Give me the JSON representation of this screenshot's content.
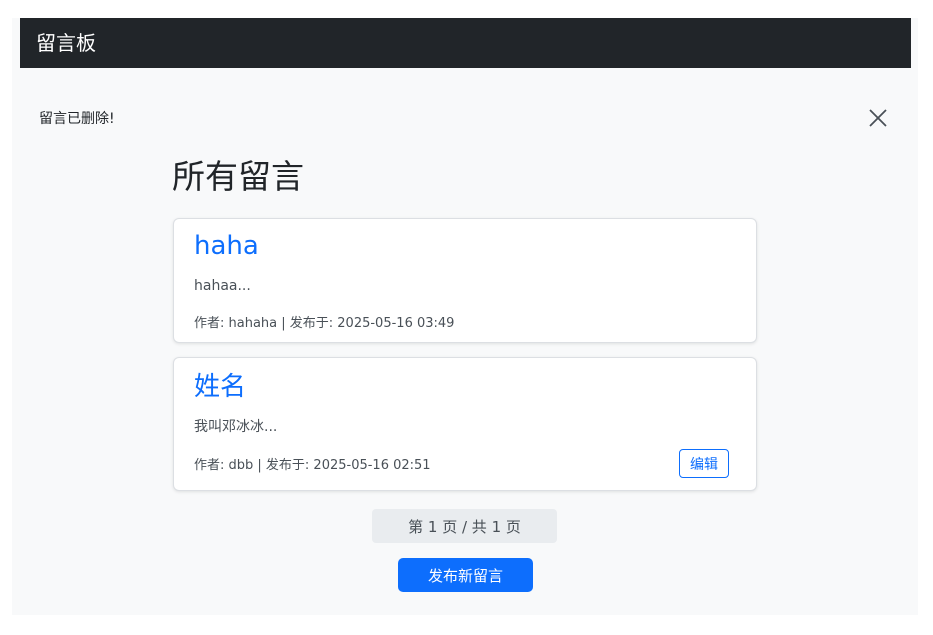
{
  "navbar": {
    "brand": "留言板"
  },
  "alert": {
    "message": "留言已删除!",
    "close_icon": "close-icon"
  },
  "main": {
    "title": "所有留言",
    "posts": [
      {
        "title": "haha",
        "excerpt": "hahaa...",
        "meta": "作者: hahaha | 发布于: 2025-05-16 03:49"
      },
      {
        "title": "姓名",
        "excerpt": "我叫邓冰冰...",
        "meta": "作者: dbb | 发布于: 2025-05-16 02:51",
        "edit_label": "编辑"
      }
    ],
    "pagination": "第 1 页 / 共 1 页",
    "new_post_label": "发布新留言"
  },
  "colors": {
    "navbar_bg": "#212529",
    "primary": "#0d6efd",
    "page_bg": "#f8f9fa"
  }
}
